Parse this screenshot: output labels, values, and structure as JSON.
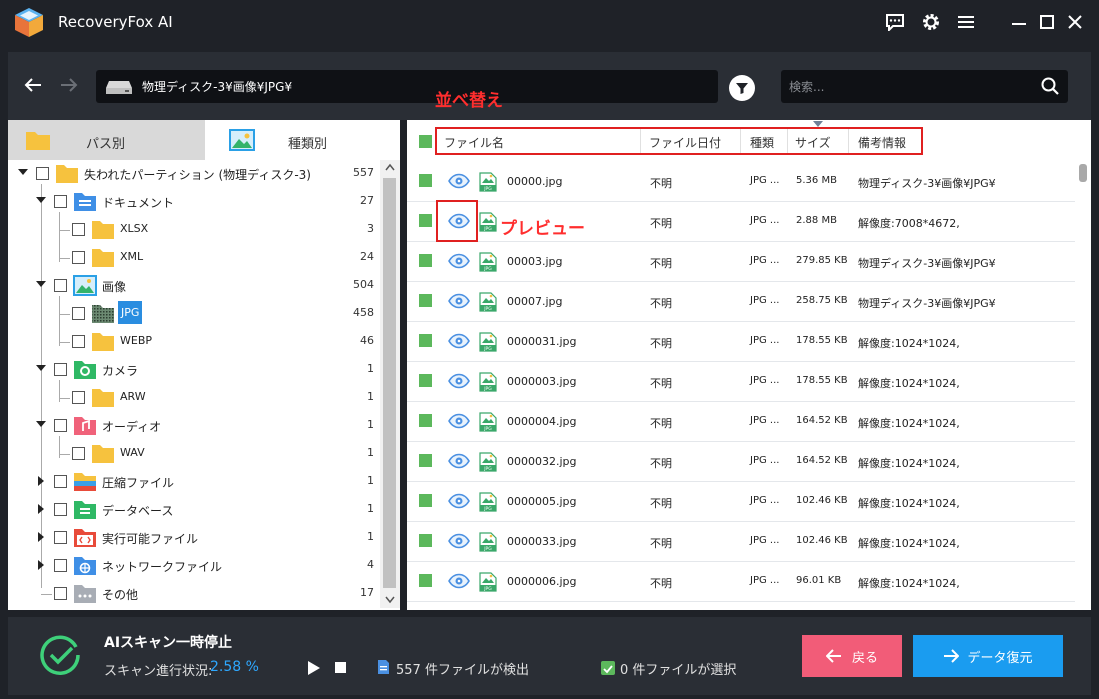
{
  "app": {
    "title": "RecoveryFox AI"
  },
  "nav": {
    "path": "物理ディスク-3¥画像¥JPG¥",
    "search_placeholder": "検索..."
  },
  "annotations": {
    "sort": "並べ替え",
    "preview": "プレビュー"
  },
  "left_panel": {
    "tabs": [
      {
        "label": "パス別"
      },
      {
        "label": "種類別"
      }
    ],
    "tree": [
      {
        "label": "失われたパーティション (物理ディスク-3)",
        "count": "557",
        "icon": "folder-icon"
      },
      {
        "label": "ドキュメント",
        "count": "27",
        "icon": "document-folder-icon"
      },
      {
        "label": "XLSX",
        "count": "3",
        "icon": "folder-icon"
      },
      {
        "label": "XML",
        "count": "24",
        "icon": "folder-icon"
      },
      {
        "label": "画像",
        "count": "504",
        "icon": "image-folder-icon"
      },
      {
        "label": "JPG",
        "count": "458",
        "icon": "folder-icon"
      },
      {
        "label": "WEBP",
        "count": "46",
        "icon": "folder-icon"
      },
      {
        "label": "カメラ",
        "count": "1",
        "icon": "camera-folder-icon"
      },
      {
        "label": "ARW",
        "count": "1",
        "icon": "folder-icon"
      },
      {
        "label": "オーディオ",
        "count": "1",
        "icon": "audio-folder-icon"
      },
      {
        "label": "WAV",
        "count": "1",
        "icon": "folder-icon"
      },
      {
        "label": "圧縮ファイル",
        "count": "1",
        "icon": "archive-folder-icon"
      },
      {
        "label": "データベース",
        "count": "1",
        "icon": "database-folder-icon"
      },
      {
        "label": "実行可能ファイル",
        "count": "1",
        "icon": "executable-folder-icon"
      },
      {
        "label": "ネットワークファイル",
        "count": "4",
        "icon": "network-folder-icon"
      },
      {
        "label": "その他",
        "count": "17",
        "icon": "other-folder-icon"
      }
    ]
  },
  "file_table": {
    "columns": [
      "ファイル名",
      "ファイル日付",
      "種類",
      "サイズ",
      "備考情報"
    ],
    "rows": [
      {
        "name": "00000.jpg",
        "date": "不明",
        "type": "JPG ...",
        "size": "5.36 MB",
        "note": "物理ディスク-3¥画像¥JPG¥"
      },
      {
        "name": "",
        "date": "不明",
        "type": "JPG ...",
        "size": "2.88 MB",
        "note": "解像度:7008*4672,"
      },
      {
        "name": "00003.jpg",
        "date": "不明",
        "type": "JPG ...",
        "size": "279.85 KB",
        "note": "物理ディスク-3¥画像¥JPG¥"
      },
      {
        "name": "00007.jpg",
        "date": "不明",
        "type": "JPG ...",
        "size": "258.75 KB",
        "note": "物理ディスク-3¥画像¥JPG¥"
      },
      {
        "name": "0000031.jpg",
        "date": "不明",
        "type": "JPG ...",
        "size": "178.55 KB",
        "note": "解像度:1024*1024,"
      },
      {
        "name": "0000003.jpg",
        "date": "不明",
        "type": "JPG ...",
        "size": "178.55 KB",
        "note": "解像度:1024*1024,"
      },
      {
        "name": "0000004.jpg",
        "date": "不明",
        "type": "JPG ...",
        "size": "164.52 KB",
        "note": "解像度:1024*1024,"
      },
      {
        "name": "0000032.jpg",
        "date": "不明",
        "type": "JPG ...",
        "size": "164.52 KB",
        "note": "解像度:1024*1024,"
      },
      {
        "name": "0000005.jpg",
        "date": "不明",
        "type": "JPG ...",
        "size": "102.46 KB",
        "note": "解像度:1024*1024,"
      },
      {
        "name": "0000033.jpg",
        "date": "不明",
        "type": "JPG ...",
        "size": "102.46 KB",
        "note": "解像度:1024*1024,"
      },
      {
        "name": "0000006.jpg",
        "date": "不明",
        "type": "JPG ...",
        "size": "96.01 KB",
        "note": "解像度:1024*1024,"
      }
    ]
  },
  "status": {
    "title": "AIスキャン一時停止",
    "progress_label": "スキャン進行状況:",
    "progress_value": "2.58 %",
    "found_text": "557 件ファイルが検出",
    "selected_text": "0 件ファイルが選択"
  },
  "buttons": {
    "back": "戻る",
    "recover": "データ復元"
  },
  "colors": {
    "accent_blue": "#1a9cf0",
    "back_pink": "#f25c78",
    "annotation_red": "#e02020",
    "check_green": "#5cb85c"
  }
}
